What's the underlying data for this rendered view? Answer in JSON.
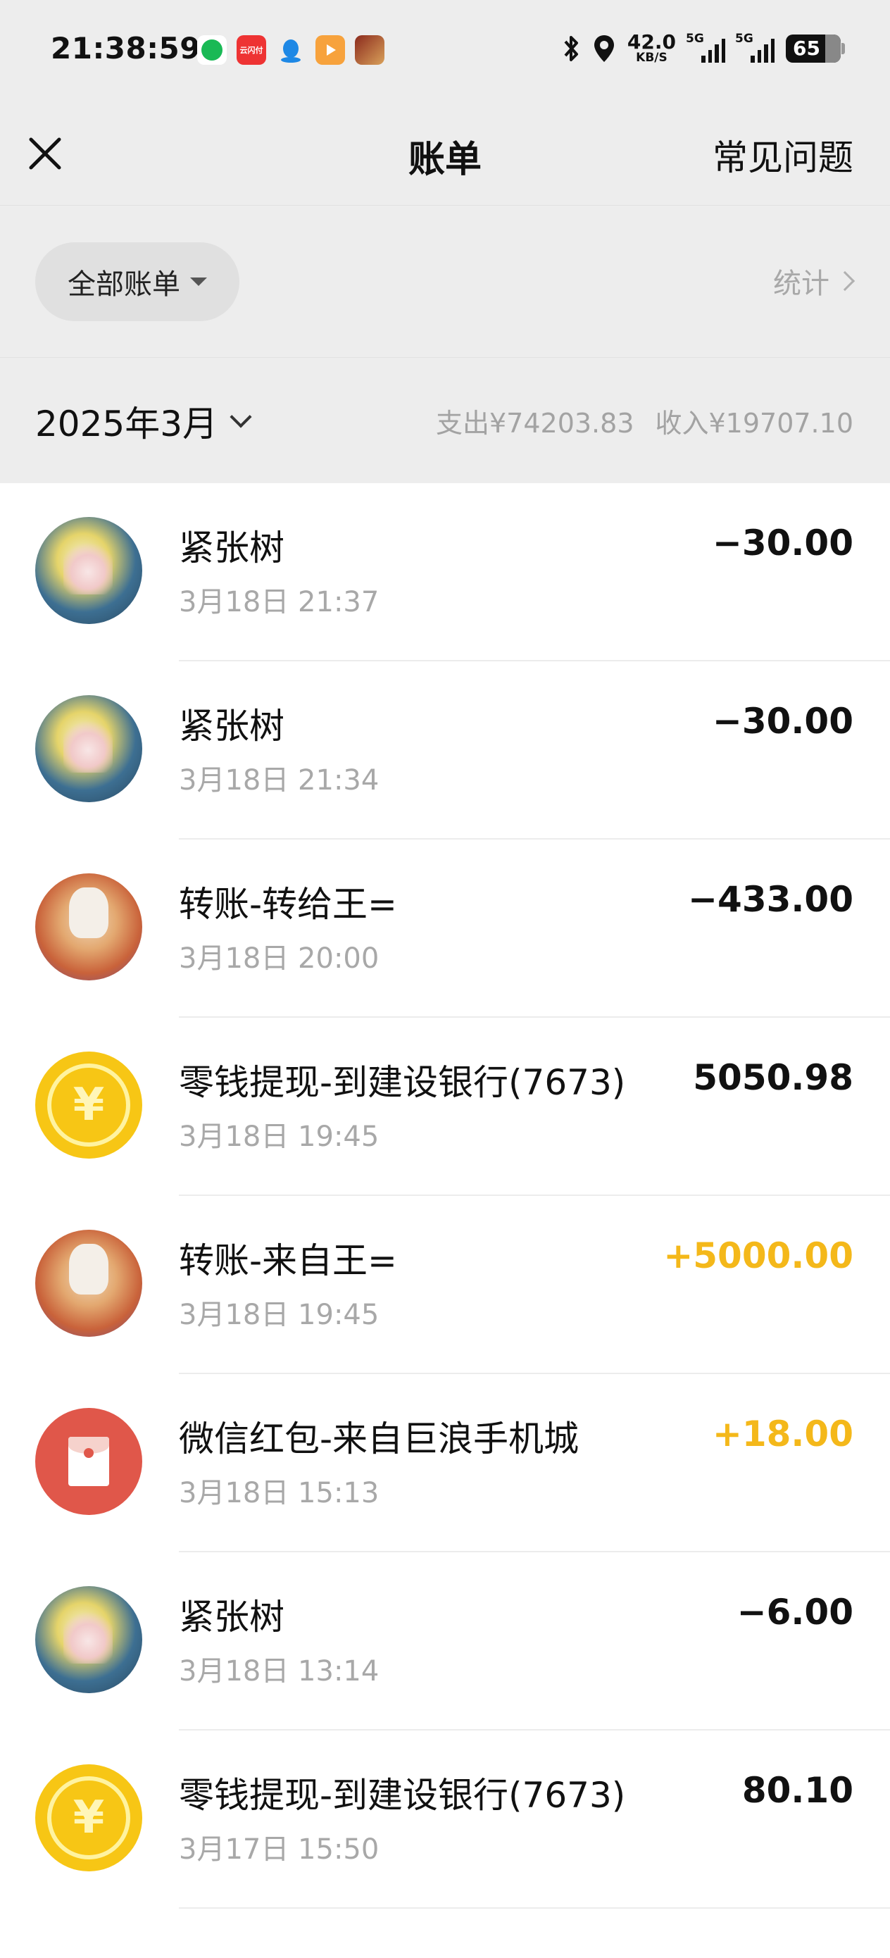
{
  "status_bar": {
    "time": "21:38:59",
    "net_speed_value": "42.0",
    "net_speed_unit": "KB/S",
    "signal1_label": "5G",
    "signal2_label": "5G",
    "battery": "65",
    "red_app_label": "云闪付"
  },
  "nav": {
    "title": "账单",
    "faq_label": "常见问题"
  },
  "filter": {
    "all_bills_label": "全部账单",
    "stats_label": "统计"
  },
  "month_bar": {
    "month_label": "2025年3月",
    "expense_label": "支出¥74203.83",
    "income_label": "收入¥19707.10"
  },
  "transactions": [
    {
      "title": "紧张树",
      "date": "3月18日 21:37",
      "amount": "−30.00",
      "avatar": "tree-avatar",
      "type": "expense"
    },
    {
      "title": "紧张树",
      "date": "3月18日 21:34",
      "amount": "−30.00",
      "avatar": "tree-avatar",
      "type": "expense"
    },
    {
      "title": "转账-转给王=",
      "date": "3月18日 20:00",
      "amount": "−433.00",
      "avatar": "wang-avatar",
      "type": "expense"
    },
    {
      "title": "零钱提现-到建设银行(7673)",
      "date": "3月18日 19:45",
      "amount": "5050.98",
      "avatar": "coin-icon",
      "type": "neutral"
    },
    {
      "title": "转账-来自王=",
      "date": "3月18日 19:45",
      "amount": "+5000.00",
      "avatar": "wang-avatar",
      "type": "income"
    },
    {
      "title": "微信红包-来自巨浪手机城",
      "date": "3月18日 15:13",
      "amount": "+18.00",
      "avatar": "red-envelope-icon",
      "type": "income"
    },
    {
      "title": "紧张树",
      "date": "3月18日 13:14",
      "amount": "−6.00",
      "avatar": "tree-avatar",
      "type": "expense"
    },
    {
      "title": "零钱提现-到建设银行(7673)",
      "date": "3月17日 15:50",
      "amount": "80.10",
      "avatar": "coin-icon",
      "type": "neutral"
    }
  ],
  "colors": {
    "header_bg": "#ededed",
    "income": "#f4b81a",
    "coin": "#f7c615",
    "red_envelope": "#e0574a"
  }
}
